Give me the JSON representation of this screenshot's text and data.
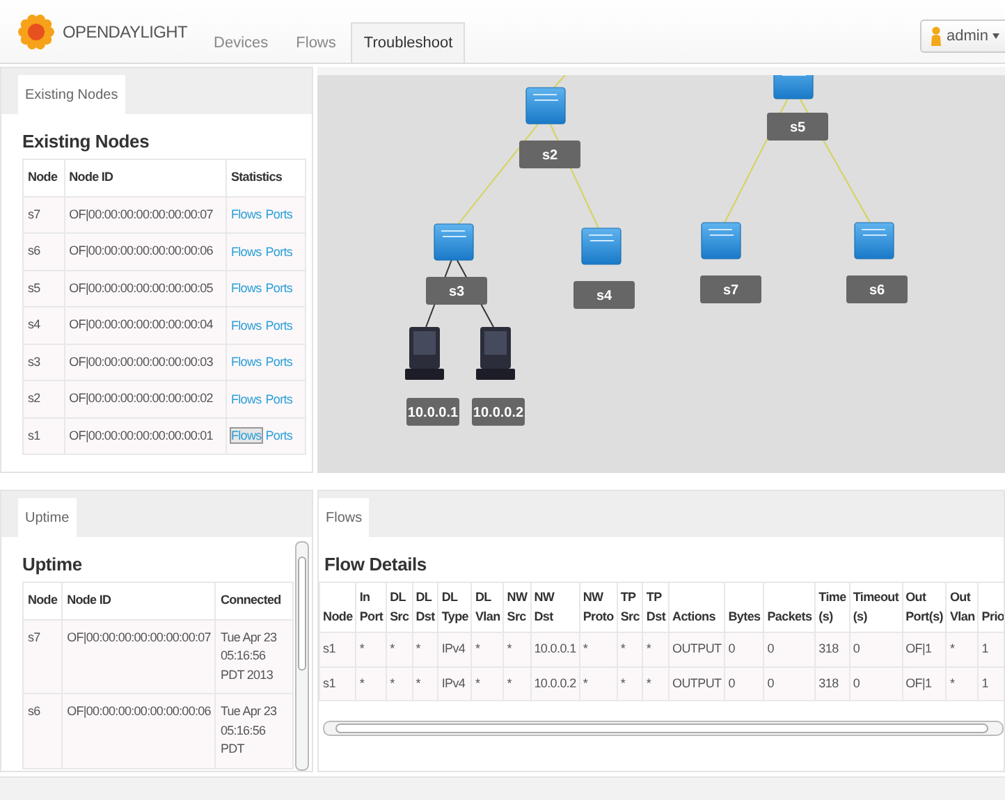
{
  "header": {
    "brand": "OPENDAYLIGHT",
    "nav": [
      {
        "label": "Devices",
        "selected": false
      },
      {
        "label": "Flows",
        "selected": false
      },
      {
        "label": "Troubleshoot",
        "selected": true
      }
    ],
    "user": "admin"
  },
  "existing_nodes": {
    "tab": {
      "label": "Existing Nodes",
      "selected": true
    },
    "title": "Existing Nodes",
    "columns": [
      "Node",
      "Node ID",
      "Statistics"
    ],
    "rows": [
      {
        "node": "s7",
        "node_id": "OF|00:00:00:00:00:00:00:07",
        "flows": "Flows",
        "ports": "Ports",
        "focused": false
      },
      {
        "node": "s6",
        "node_id": "OF|00:00:00:00:00:00:00:06",
        "flows": "Flows",
        "ports": "Ports",
        "focused": false
      },
      {
        "node": "s5",
        "node_id": "OF|00:00:00:00:00:00:00:05",
        "flows": "Flows",
        "ports": "Ports",
        "focused": false
      },
      {
        "node": "s4",
        "node_id": "OF|00:00:00:00:00:00:00:04",
        "flows": "Flows",
        "ports": "Ports",
        "focused": false
      },
      {
        "node": "s3",
        "node_id": "OF|00:00:00:00:00:00:00:03",
        "flows": "Flows",
        "ports": "Ports",
        "focused": false
      },
      {
        "node": "s2",
        "node_id": "OF|00:00:00:00:00:00:00:02",
        "flows": "Flows",
        "ports": "Ports",
        "focused": false
      },
      {
        "node": "s1",
        "node_id": "OF|00:00:00:00:00:00:00:01",
        "flows": "Flows",
        "ports": "Ports",
        "focused": true
      }
    ]
  },
  "topology": {
    "nodes": [
      {
        "label": "s2",
        "kind": "switch"
      },
      {
        "label": "s5",
        "kind": "switch"
      },
      {
        "label": "s3",
        "kind": "switch"
      },
      {
        "label": "s4",
        "kind": "switch"
      },
      {
        "label": "s7",
        "kind": "switch"
      },
      {
        "label": "s6",
        "kind": "switch"
      },
      {
        "label": "10.0.0.1",
        "kind": "host"
      },
      {
        "label": "10.0.0.2",
        "kind": "host"
      }
    ]
  },
  "uptime": {
    "tab": {
      "label": "Uptime",
      "selected": true
    },
    "title": "Uptime",
    "columns": [
      "Node",
      "Node ID",
      "Connected"
    ],
    "rows": [
      {
        "node": "s7",
        "node_id": "OF|00:00:00:00:00:00:00:07",
        "connected": "Tue Apr 23 05:16:56 PDT 2013"
      },
      {
        "node": "s6",
        "node_id": "OF|00:00:00:00:00:00:00:06",
        "connected": "Tue Apr 23 05:16:56 PDT"
      }
    ]
  },
  "flows": {
    "tab": {
      "label": "Flows",
      "selected": true
    },
    "title": "Flow Details",
    "columns": [
      "Node",
      "In Port",
      "DL Src",
      "DL Dst",
      "DL Type",
      "DL Vlan",
      "NW Src",
      "NW Dst",
      "NW Proto",
      "TP Src",
      "TP Dst",
      "Actions",
      "Bytes",
      "Packets",
      "Time (s)",
      "Timeout (s)",
      "Out Port(s)",
      "Out Vlan",
      "Prio"
    ],
    "rows": [
      [
        "s1",
        "*",
        "*",
        "*",
        "IPv4",
        "*",
        "*",
        "10.0.0.1",
        "*",
        "*",
        "*",
        "OUTPUT",
        "0",
        "0",
        "318",
        "0",
        "OF|1",
        "*",
        "1"
      ],
      [
        "s1",
        "*",
        "*",
        "*",
        "IPv4",
        "*",
        "*",
        "10.0.0.2",
        "*",
        "*",
        "*",
        "OUTPUT",
        "0",
        "0",
        "318",
        "0",
        "OF|1",
        "*",
        "1"
      ]
    ]
  }
}
